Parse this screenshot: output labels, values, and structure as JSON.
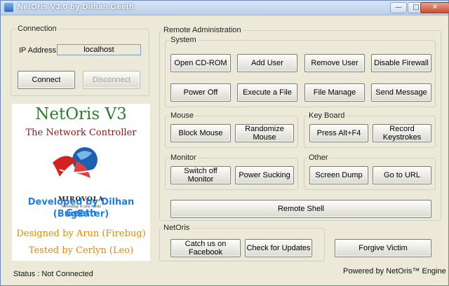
{
  "window": {
    "title": "NetOris V3.0 by Dilhan Geeth",
    "minimize_glyph": "—",
    "maximize_glyph": "□",
    "close_glyph": "✕"
  },
  "connection": {
    "group_label": "Connection",
    "ip_label": "IP Address",
    "ip_value": "localhost",
    "connect_label": "Connect",
    "disconnect_label": "Disconnect"
  },
  "branding": {
    "title": "NetOris V3",
    "subtitle": "The Network Controller",
    "logo_text": "MIROVOLA",
    "logo_tagline": "Technology in your hands",
    "developed_by": "Developed by Dilhan Geeth",
    "developer_alias": "(BugEater)",
    "designed_by": "Designed by Arun (Firebug)",
    "tested_by": "Tested by Cerlyn (Leo)"
  },
  "remote_admin": {
    "group_label": "Remote Administration",
    "system": {
      "label": "System",
      "buttons": [
        "Open CD-ROM",
        "Add User",
        "Remove User",
        "Disable Firewall",
        "Power Off",
        "Execute a File",
        "File Manage",
        "Send Message"
      ]
    },
    "mouse": {
      "label": "Mouse",
      "buttons": [
        "Block Mouse",
        "Randomize Mouse"
      ]
    },
    "keyboard": {
      "label": "Key Board",
      "buttons": [
        "Press  Alt+F4",
        "Record Keystrokes"
      ]
    },
    "monitor": {
      "label": "Monitor",
      "buttons": [
        "Switch off Monitor",
        "Power Sucking"
      ]
    },
    "other": {
      "label": "Other",
      "buttons": [
        "Screen Dump",
        "Go to URL"
      ]
    },
    "remote_shell_label": "Remote Shell"
  },
  "netoris": {
    "group_label": "NetOris",
    "facebook_label": "Catch us on Facebook",
    "updates_label": "Check for Updates",
    "forgive_label": "Forgive Victim"
  },
  "status": {
    "text": "Status : Not Connected",
    "powered_by": "Powered by NetOris™ Engine"
  }
}
